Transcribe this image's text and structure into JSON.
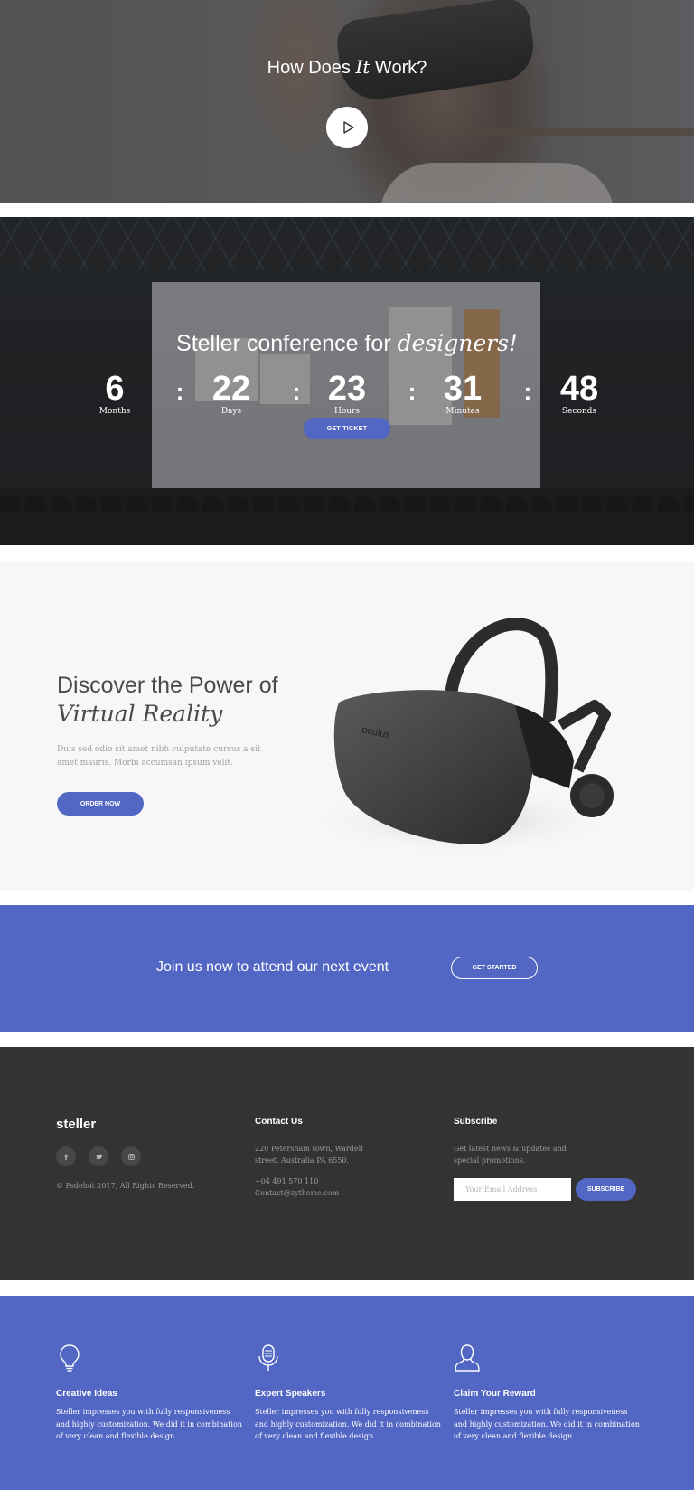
{
  "video_section": {
    "title_pre": "How Does ",
    "title_em": "It",
    "title_post": " Work?"
  },
  "countdown": {
    "title_pre": "Steller conference for ",
    "title_em": "designers!",
    "units": [
      {
        "value": "6",
        "label": "Months"
      },
      {
        "value": "22",
        "label": "Days"
      },
      {
        "value": "23",
        "label": "Hours"
      },
      {
        "value": "31",
        "label": "Minutes"
      },
      {
        "value": "48",
        "label": "Seconds"
      }
    ],
    "separator": ":",
    "button_label": "GET TICKET"
  },
  "discover": {
    "title_line1": "Discover the Power of",
    "title_line2": "Virtual Reality",
    "description": "Duis sed odio sit amet nibh vulputate cursus a sit amet mauris. Morbi accumsan ipsum velit.",
    "button_label": "ORDER NOW",
    "product_brand": "oculus"
  },
  "join": {
    "text": "Join us now to attend our next event",
    "button_label": "GET STARTED"
  },
  "footer": {
    "logo": "steller",
    "social_icons": [
      "facebook-icon",
      "twitter-icon",
      "instagram-icon"
    ],
    "copyright": "© Psdehat 2017, All Rights Reserved.",
    "contact": {
      "title": "Contact Us",
      "address_line1": "220 Petersham town, Wardell",
      "address_line2": "street, Australia PA 6550.",
      "phone": "+04 491 570 110",
      "email": "Contact@zytheme.com"
    },
    "subscribe": {
      "title": "Subscribe",
      "text_line1": "Get latest news & updates and",
      "text_line2": "special promotions.",
      "input_placeholder": "Your Email Address",
      "button_label": "SUBSCRIBE"
    }
  },
  "features": [
    {
      "icon": "lightbulb-icon",
      "title": "Creative Ideas",
      "text": "Steller impresses you with fully responsiveness and highly customization. We did it in combination of very clean and flexible design."
    },
    {
      "icon": "microphone-icon",
      "title": "Expert Speakers",
      "text": "Steller impresses you with fully responsiveness and highly customization. We did it in combination of very clean and flexible design."
    },
    {
      "icon": "user-icon",
      "title": "Claim Your Reward",
      "text": "Steller impresses you with fully responsiveness and highly customization. We did it in combination of very clean and flexible design."
    }
  ],
  "colors": {
    "accent": "#5266c3",
    "footer_bg": "#333333",
    "section_bg": "#f7f7f7"
  }
}
